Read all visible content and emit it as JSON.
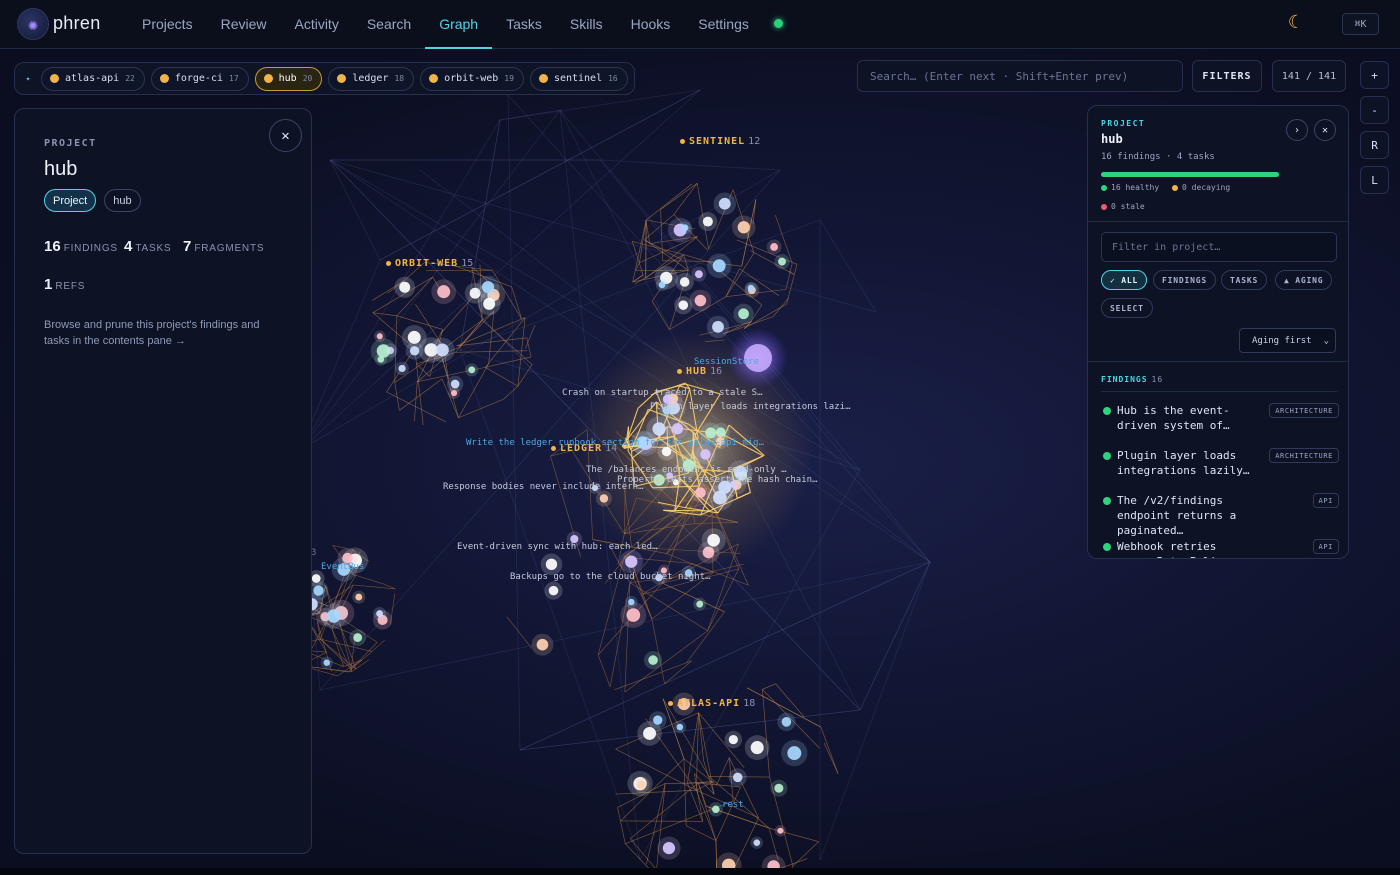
{
  "app": {
    "brand": "phren",
    "logo_icon": "brain-icon",
    "kbd_hint": "⌘K",
    "theme_icon": "☾"
  },
  "nav": {
    "items": [
      {
        "label": "Projects"
      },
      {
        "label": "Review"
      },
      {
        "label": "Activity"
      },
      {
        "label": "Search"
      },
      {
        "label": "Graph",
        "active": true
      },
      {
        "label": "Tasks"
      },
      {
        "label": "Skills"
      },
      {
        "label": "Hooks"
      },
      {
        "label": "Settings"
      }
    ]
  },
  "chips": {
    "first_icon": "✦",
    "items": [
      {
        "label": "atlas-api",
        "count": "22"
      },
      {
        "label": "forge-ci",
        "count": "17"
      },
      {
        "label": "hub",
        "count": "20",
        "active": true
      },
      {
        "label": "ledger",
        "count": "18"
      },
      {
        "label": "orbit-web",
        "count": "19"
      },
      {
        "label": "sentinel",
        "count": "16"
      }
    ]
  },
  "toolbar": {
    "search_placeholder": "Search… (Enter next · Shift+Enter prev)",
    "filters_label": "FILTERS",
    "count": "141 / 141",
    "zoom": [
      "+",
      "-",
      "R",
      "L"
    ]
  },
  "graph": {
    "clusters": [
      {
        "name": "SENTINEL",
        "count": "12"
      },
      {
        "name": "ORBIT-WEB",
        "count": "15"
      },
      {
        "name": "HUB",
        "count": "16"
      },
      {
        "name": "LEDGER",
        "count": "14"
      },
      {
        "name": "ATLAS-API",
        "count": "18"
      }
    ],
    "node_labels": [
      "SessionStore",
      "Crash on startup traced to a stale S…",
      "Plugin layer loads integrations lazi…",
      "Write the ledger runbook section for the atlas-api mig…",
      "The /balances endpoint is read-only …",
      "Property tests assert the hash chain…",
      "Response bodies never include intern…",
      "Event-driven sync with hub: each led…",
      "Backups go to the cloud bucket night…",
      "EventBus",
      "rest",
      "3"
    ]
  },
  "left_panel": {
    "kicker": "PROJECT",
    "title": "hub",
    "tags": [
      "Project",
      "hub"
    ],
    "stats": [
      {
        "value": "16",
        "label": "FINDINGS"
      },
      {
        "value": "4",
        "label": "TASKS"
      },
      {
        "value": "7",
        "label": "FRAGMENTS"
      },
      {
        "value": "1",
        "label": "REFS"
      }
    ],
    "description": "Browse and prune this project's findings and tasks in the contents pane →",
    "close_icon": "✕"
  },
  "right_panel": {
    "kicker": "PROJECT",
    "title": "hub",
    "subtitle": "16 findings · 4 tasks",
    "health_fraction": 1.0,
    "legend": [
      {
        "label": "16 healthy",
        "color": "#2fd37e"
      },
      {
        "label": "0 decaying",
        "color": "#f0b44a"
      },
      {
        "label": "0 stale",
        "color": "#ef5a6f"
      }
    ],
    "filter_placeholder": "Filter in project…",
    "pills": [
      "✓ ALL",
      "FINDINGS",
      "TASKS",
      "▲ AGING",
      "SELECT"
    ],
    "sort_label": "Aging first",
    "sort_icon": "⌄",
    "findings_heading": "FINDINGS",
    "findings_count": "16",
    "findings": [
      {
        "text": "Hub is the event-driven system of…",
        "badge": "ARCHITECTURE"
      },
      {
        "text": "Plugin layer loads integrations lazily…",
        "badge": "ARCHITECTURE"
      },
      {
        "text": "The /v2/findings endpoint returns a paginated…",
        "badge": "API"
      },
      {
        "text": "Webhook retries reuse RetryPolicy with exponentia…",
        "badge": "API"
      }
    ],
    "expand_icon": "›",
    "close_icon": "✕"
  }
}
